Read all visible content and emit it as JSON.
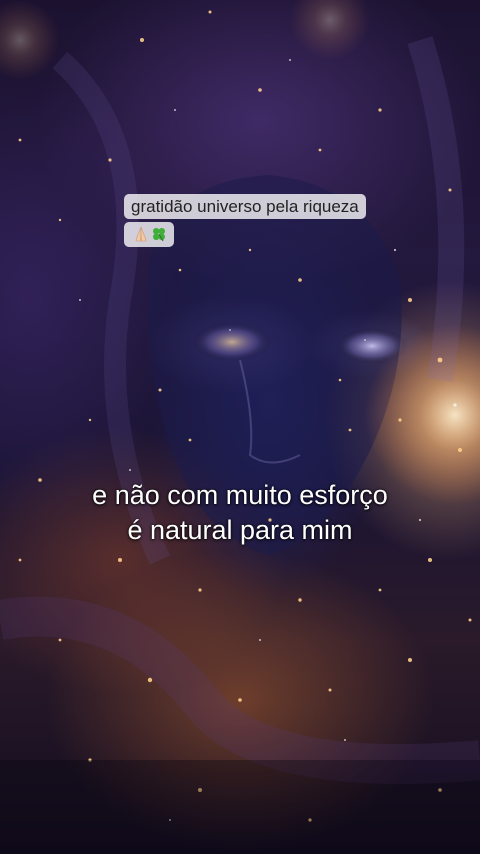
{
  "sticker": {
    "text": "gratidão universo pela riqueza",
    "emojis": [
      "praying-hands",
      "four-leaf-clover"
    ]
  },
  "caption": {
    "line1": "e não com muito esforço",
    "line2": "é natural para mim"
  },
  "colors": {
    "caption_text": "#ffffff",
    "sticker_bg": "#ffffff",
    "sticker_text": "#222222",
    "accent_glow": "#ffb872"
  }
}
